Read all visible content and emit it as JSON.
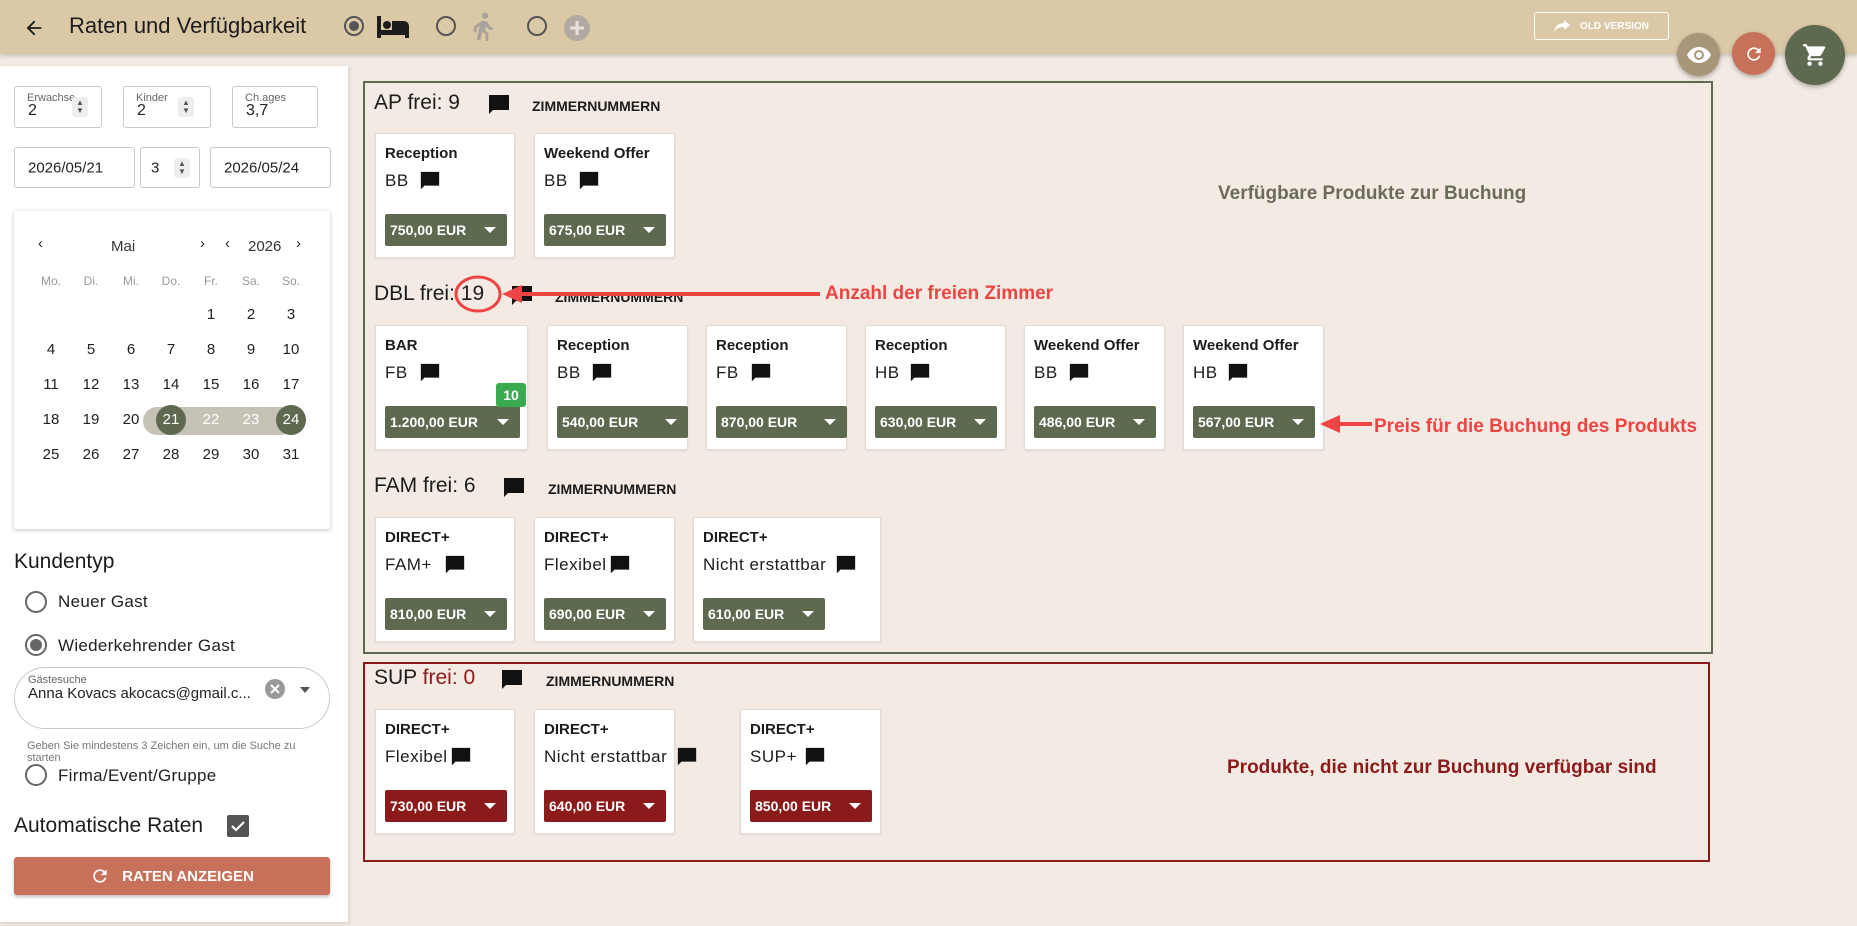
{
  "header": {
    "title": "Raten und Verfügbarkeit",
    "old_version": "OLD VERSION",
    "back_icon": "arrow-left-icon",
    "mode_icons": [
      "bed-icon",
      "walking-person-icon",
      "plus-circle-icon"
    ]
  },
  "colors": {
    "topbar": "#dbc8a6",
    "accent_green": "#5d6a50",
    "accent_red": "#8b1a1a",
    "button_orange": "#c8715a",
    "badge_green": "#3aaa4e",
    "annotation_red": "#ef4444"
  },
  "search": {
    "adults_label": "Erwachse...",
    "adults_value": "2",
    "children_label": "Kinder",
    "children_value": "2",
    "ages_label": "Ch.ages",
    "ages_value": "3,7",
    "arrival": "2026/05/21",
    "nights": "3",
    "departure": "2026/05/24"
  },
  "calendar": {
    "month": "Mai",
    "year": "2026",
    "weekdays": [
      "Mo.",
      "Di.",
      "Mi.",
      "Do.",
      "Fr.",
      "Sa.",
      "So."
    ],
    "days": [
      "1",
      "2",
      "3",
      "4",
      "5",
      "6",
      "7",
      "8",
      "9",
      "10",
      "11",
      "12",
      "13",
      "14",
      "15",
      "16",
      "17",
      "18",
      "19",
      "20",
      "21",
      "22",
      "23",
      "24",
      "25",
      "26",
      "27",
      "28",
      "29",
      "30",
      "31"
    ],
    "selected_start": "21",
    "selected_end": "24"
  },
  "customer": {
    "heading": "Kundentyp",
    "new_guest": "Neuer Gast",
    "returning_guest": "Wiederkehrender Gast",
    "guest_search_label": "Gästesuche",
    "guest_search_value": "Anna Kovacs akocacs@gmail.c...",
    "hint": "Geben Sie mindestens 3 Zeichen ein, um die Suche zu starten",
    "company": "Firma/Event/Gruppe"
  },
  "auto_rates": {
    "label": "Automatische Raten",
    "checked": true,
    "button": "RATEN ANZEIGEN"
  },
  "rooms": [
    {
      "code": "AP",
      "frei_label": "frei:",
      "free": "9",
      "zimmer": "ZIMMERNUMMERN",
      "products": [
        {
          "rate": "Reception",
          "plan": "BB",
          "price": "750,00 EUR"
        },
        {
          "rate": "Weekend Offer",
          "plan": "BB",
          "price": "675,00 EUR"
        }
      ]
    },
    {
      "code": "DBL",
      "frei_label": "frei:",
      "free": "19",
      "zimmer": "ZIMMERNUMMERN",
      "products": [
        {
          "rate": "BAR",
          "plan": "FB",
          "price": "1.200,00 EUR",
          "badge": "10"
        },
        {
          "rate": "Reception",
          "plan": "BB",
          "price": "540,00 EUR"
        },
        {
          "rate": "Reception",
          "plan": "FB",
          "price": "870,00 EUR"
        },
        {
          "rate": "Reception",
          "plan": "HB",
          "price": "630,00 EUR"
        },
        {
          "rate": "Weekend Offer",
          "plan": "BB",
          "price": "486,00 EUR"
        },
        {
          "rate": "Weekend Offer",
          "plan": "HB",
          "price": "567,00 EUR"
        }
      ]
    },
    {
      "code": "FAM",
      "frei_label": "frei:",
      "free": "6",
      "zimmer": "ZIMMERNUMMERN",
      "products": [
        {
          "rate": "DIRECT+",
          "plan": "FAM+",
          "price": "810,00 EUR"
        },
        {
          "rate": "DIRECT+",
          "plan": "Flexibel",
          "price": "690,00 EUR"
        },
        {
          "rate": "DIRECT+",
          "plan": "Nicht erstattbar",
          "price": "610,00 EUR"
        }
      ]
    },
    {
      "code": "SUP",
      "frei_label": "frei:",
      "free": "0",
      "zimmer": "ZIMMERNUMMERN",
      "products": [
        {
          "rate": "DIRECT+",
          "plan": "Flexibel",
          "price": "730,00 EUR"
        },
        {
          "rate": "DIRECT+",
          "plan": "Nicht erstattbar",
          "price": "640,00 EUR"
        },
        {
          "rate": "DIRECT+",
          "plan": "SUP+",
          "price": "850,00 EUR"
        }
      ]
    }
  ],
  "annotations": {
    "available": "Verfügbare Produkte zur Buchung",
    "free_rooms": "Anzahl der freien Zimmer",
    "price": "Preis für die Buchung des Produkts",
    "unavailable": "Produkte, die nicht zur Buchung verfügbar sind"
  }
}
